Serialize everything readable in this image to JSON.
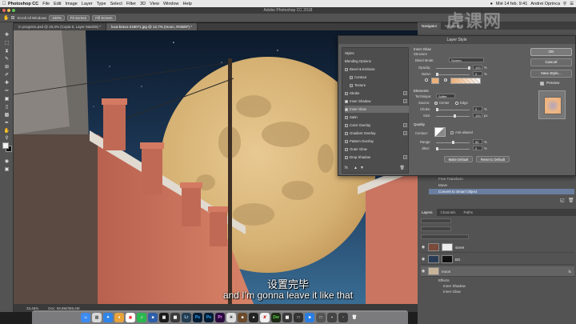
{
  "menubar": {
    "app": "Photoshop CC",
    "items": [
      "File",
      "Edit",
      "Image",
      "Layer",
      "Type",
      "Select",
      "Filter",
      "3D",
      "View",
      "Window",
      "Help"
    ],
    "status_right": "Mié 14 feb. 9:41",
    "user": "Andrei Oprinca"
  },
  "titlebar": {
    "title": "Adobe Photoshop CC 2018"
  },
  "options_bar": {
    "scroll_all_windows": "Scroll All Windows",
    "zoom_100": "100%",
    "fit_screen": "Fit Screen",
    "fill_screen": "Fill Screen"
  },
  "doc_tabs": [
    {
      "label": "In progress.psd @ 33,3% (Copia 6, Layer Mask/8) *",
      "active": false
    },
    {
      "label": "luca-bravo-218071.jpg @ 12,7% (moon, RGB/8*) *",
      "active": true
    }
  ],
  "status_bar": {
    "zoom": "33,46%",
    "doc": "Doc: 59,8M/359,2M"
  },
  "right_panel": {
    "top_tabs": [
      "Navigator",
      "Histogram"
    ],
    "history_items": [
      "Free Transform",
      "Move",
      "Convert to Smart Object"
    ],
    "layers_tabs": [
      "Layers",
      "Channels",
      "Paths"
    ],
    "layers": [
      {
        "name": "street",
        "kind": "street"
      },
      {
        "name": "BG",
        "kind": "bg"
      },
      {
        "name": "moon",
        "kind": "moon"
      }
    ],
    "effects_label": "Effects",
    "effects": [
      "Inner Shadow",
      "Inner Glow"
    ]
  },
  "dialog": {
    "title": "Layer Style",
    "styles_header": "Styles",
    "blending_options": "Blending Options",
    "styles": [
      {
        "label": "Bevel & Emboss",
        "checked": false,
        "plus": false,
        "indent": false
      },
      {
        "label": "Contour",
        "checked": false,
        "plus": false,
        "indent": true
      },
      {
        "label": "Texture",
        "checked": false,
        "plus": false,
        "indent": true
      },
      {
        "label": "Stroke",
        "checked": false,
        "plus": true,
        "indent": false
      },
      {
        "label": "Inner Shadow",
        "checked": true,
        "plus": true,
        "indent": false
      },
      {
        "label": "Inner Glow",
        "checked": true,
        "plus": false,
        "indent": false,
        "selected": true
      },
      {
        "label": "Satin",
        "checked": false,
        "plus": false,
        "indent": false
      },
      {
        "label": "Color Overlay",
        "checked": false,
        "plus": true,
        "indent": false
      },
      {
        "label": "Gradient Overlay",
        "checked": false,
        "plus": true,
        "indent": false
      },
      {
        "label": "Pattern Overlay",
        "checked": false,
        "plus": false,
        "indent": false
      },
      {
        "label": "Outer Glow",
        "checked": false,
        "plus": false,
        "indent": false
      },
      {
        "label": "Drop Shadow",
        "checked": false,
        "plus": true,
        "indent": false
      }
    ],
    "inner_glow": {
      "section": "Inner Glow",
      "structure": "Structure",
      "blend_mode_label": "Blend Mode:",
      "blend_mode": "Screen",
      "opacity_label": "Opacity:",
      "opacity": "100",
      "noise_label": "Noise:",
      "noise": "0",
      "elements": "Elements",
      "technique_label": "Technique:",
      "technique": "Softer",
      "source_label": "Source:",
      "source_center": "Center",
      "source_edge": "Edge",
      "choke_label": "Choke:",
      "choke": "0",
      "size_label": "Size:",
      "size": "100",
      "px": "px",
      "quality": "Quality",
      "contour_label": "Contour:",
      "anti_aliased": "Anti-aliased",
      "range_label": "Range:",
      "range": "50",
      "jitter_label": "Jitter:",
      "jitter": "0",
      "pct": "%",
      "make_default": "Make Default",
      "reset_default": "Reset to Default"
    },
    "buttons": {
      "ok": "OK",
      "cancel": "Cancel",
      "new_style": "New Style...",
      "preview": "Preview"
    },
    "glow_color": "#ecb07a"
  },
  "subtitles": {
    "cn": "设置完毕",
    "en": "and I’m gonna leave it like that"
  },
  "watermark": "虎课网"
}
